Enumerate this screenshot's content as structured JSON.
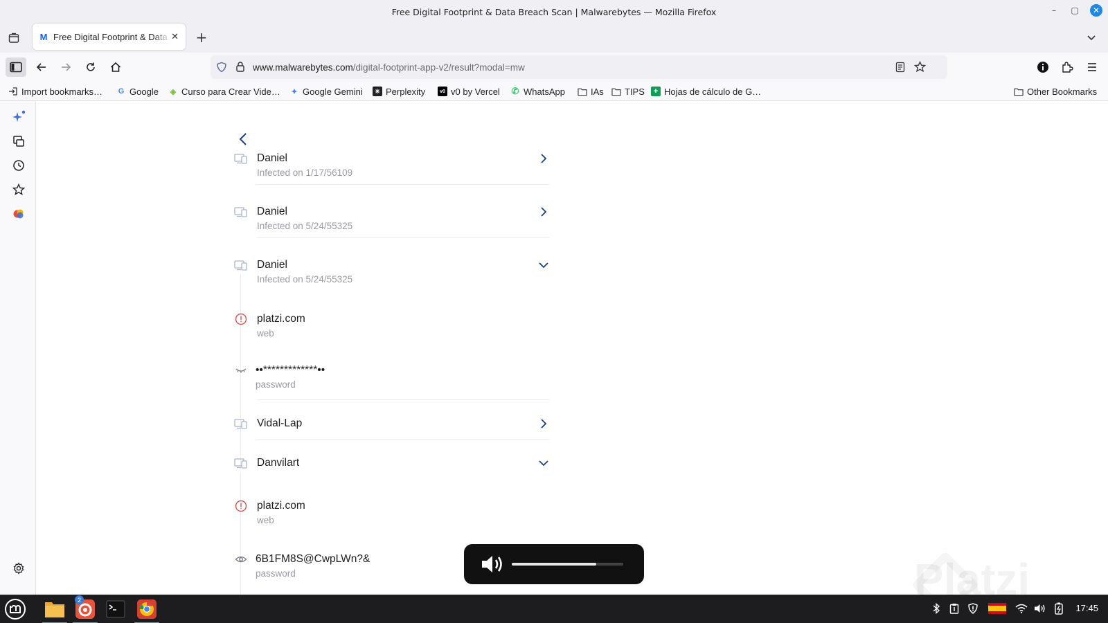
{
  "window": {
    "title": "Free Digital Footprint & Data Breach Scan | Malwarebytes — Mozilla Firefox",
    "minimize": "–",
    "maximize": "▢",
    "close": "✕"
  },
  "tabs": [
    {
      "title": "Free Digital Footprint & Data Breach Scan",
      "favicon": "M",
      "close": "✕"
    }
  ],
  "new_tab": "+",
  "urlbar": {
    "host": "www.malwarebytes.com",
    "path": "/digital-footprint-app-v2/result?modal=mw"
  },
  "bookmarks": [
    {
      "label": "Import bookmarks…",
      "icon": "import-icon"
    },
    {
      "label": "Google",
      "icon": "google-icon",
      "glyph": "G",
      "color": "#4285f4"
    },
    {
      "label": "Curso para Crear Vide…",
      "icon": "curso-icon",
      "glyph": "◈",
      "color": "#7cc142"
    },
    {
      "label": "Google Gemini",
      "icon": "gemini-icon",
      "glyph": "✦",
      "color": "#4a7ef0"
    },
    {
      "label": "Perplexity",
      "icon": "perplexity-icon",
      "glyph": "✳",
      "color": "#222222"
    },
    {
      "label": "v0 by Vercel",
      "icon": "v0-icon",
      "glyph": "v0",
      "color": "#000000"
    },
    {
      "label": "WhatsApp",
      "icon": "whatsapp-icon",
      "glyph": "✆",
      "color": "#25d366"
    },
    {
      "label": "IAs",
      "icon": "folder-icon"
    },
    {
      "label": "TIPS",
      "icon": "folder-icon"
    },
    {
      "label": "Hojas de cálculo de G…",
      "icon": "sheets-icon",
      "glyph": "+",
      "color": "#0f9d58"
    }
  ],
  "other_bookmarks": "Other Bookmarks",
  "results": [
    {
      "type": "device",
      "title": "Daniel",
      "subtitle": "Infected on 1/17/56109",
      "chevron": "right"
    },
    {
      "type": "device",
      "title": "Daniel",
      "subtitle": "Infected on 5/24/55325",
      "chevron": "right"
    },
    {
      "type": "device",
      "title": "Daniel",
      "subtitle": "Infected on 5/24/55325",
      "chevron": "down"
    },
    {
      "type": "alert",
      "title": "platzi.com",
      "subtitle": "web"
    },
    {
      "type": "hidden-password",
      "title": "••*************••",
      "subtitle": "password"
    },
    {
      "type": "device",
      "title": "Vidal-Lap",
      "subtitle": "",
      "chevron": "right"
    },
    {
      "type": "device",
      "title": "Danvilart",
      "subtitle": "",
      "chevron": "down"
    },
    {
      "type": "alert",
      "title": "platzi.com",
      "subtitle": "web"
    },
    {
      "type": "visible-password",
      "title": "6B1FM8S@CwpLWn?&",
      "subtitle": "password"
    }
  ],
  "volume_osd": {
    "level": 0.76
  },
  "watermark": "Platzi",
  "taskbar": {
    "apps": [
      "menu-icon",
      "files-icon",
      "firefox-icon",
      "terminal-icon",
      "chrome-icon"
    ],
    "firefox_badge": "2",
    "clock": "17:45"
  },
  "colors": {
    "accent_blue": "#1b3f87",
    "alert_red": "#d9534f",
    "device_icon": "#a9b3c9"
  }
}
